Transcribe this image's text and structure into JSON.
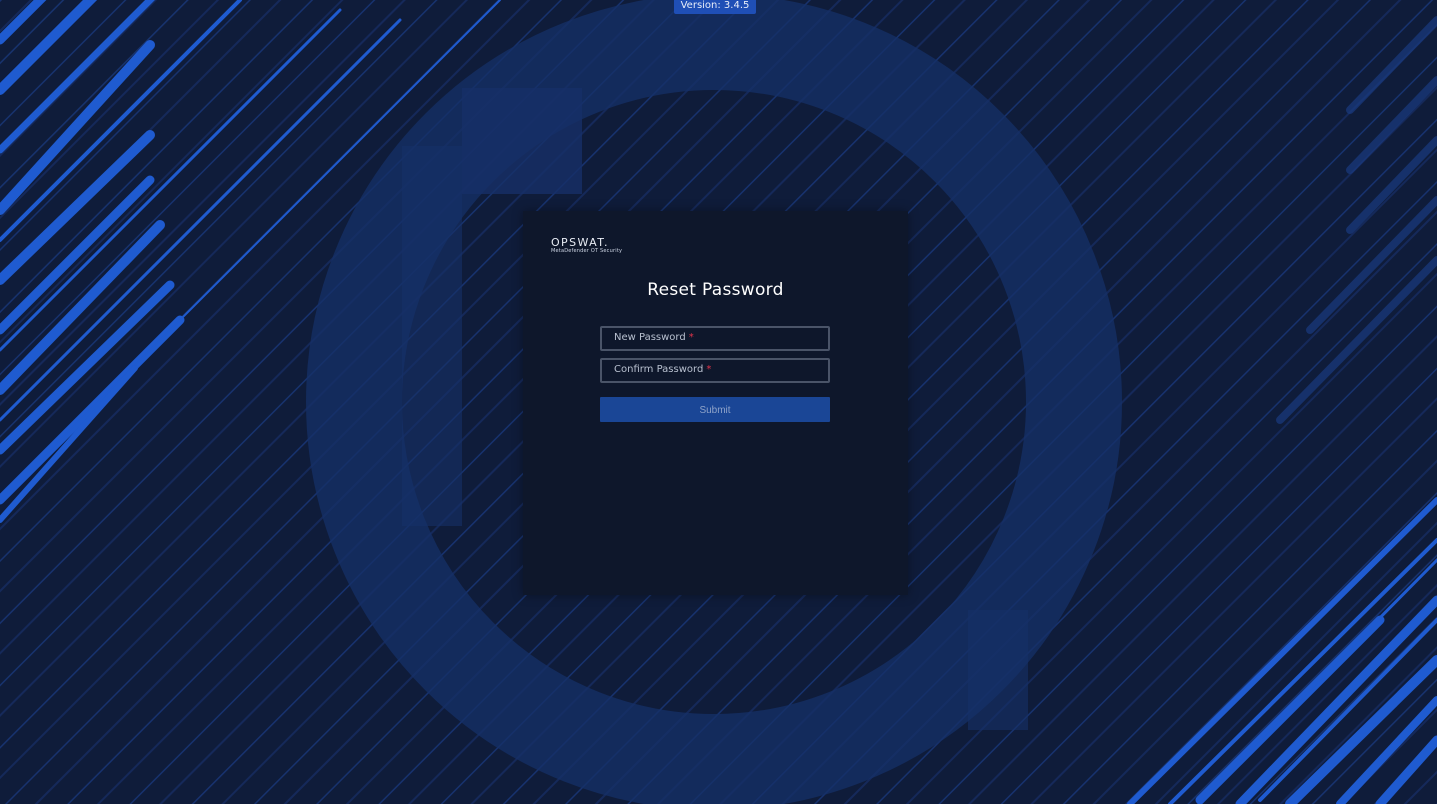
{
  "version_badge": "Version: 3.4.5",
  "logo": {
    "word": "OPSWAT.",
    "subtitle": "MetaDefender OT Security"
  },
  "form": {
    "title": "Reset Password",
    "fields": [
      {
        "label": "New Password",
        "required_mark": "*",
        "value": ""
      },
      {
        "label": "Confirm Password",
        "required_mark": "*",
        "value": ""
      }
    ],
    "submit_label": "Submit"
  },
  "colors": {
    "background": "#0f1c3a",
    "accent_stripes": "#1f5bd0",
    "card": "#0e172b",
    "button": "#1a4696",
    "required": "#e0344a"
  }
}
